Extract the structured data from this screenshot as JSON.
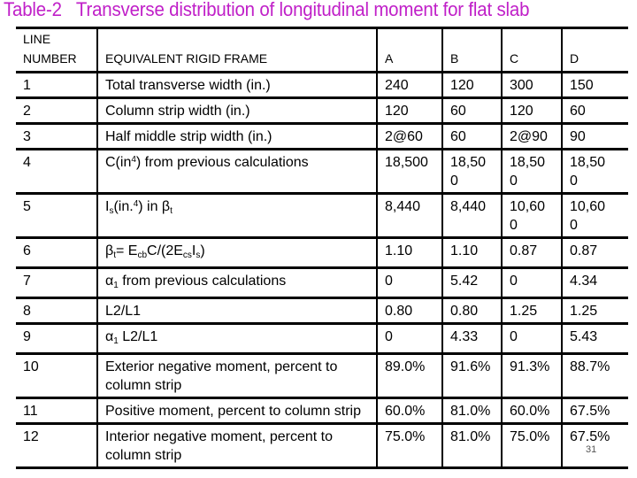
{
  "title": "Table-2   Transverse distribution of longitudinal moment for flat slab",
  "table": {
    "headers": {
      "line_number": [
        "LINE",
        "NUMBER"
      ],
      "frame": "EQUIVALENT RIGID FRAME",
      "A": "A",
      "B": "B",
      "C": "C",
      "D": "D"
    },
    "rows": [
      {
        "n": "1",
        "label": "Total transverse width (in.)",
        "A": "240",
        "B": "120",
        "C": "300",
        "D": "150"
      },
      {
        "n": "2",
        "label": "Column strip width (in.)",
        "A": "120",
        "B": "60",
        "C": "120",
        "D": "60"
      },
      {
        "n": "3",
        "label": "Half middle strip width (in.)",
        "A": "2@60",
        "B": "60",
        "C": "2@90",
        "D": "90"
      },
      {
        "n": "4",
        "label_parts": {
          "a": "C(in",
          "sup": "4",
          "b": ") from previous calculations"
        },
        "A": "18,500",
        "B": "18,500",
        "C": "18,500",
        "D": "18,500"
      },
      {
        "n": "5",
        "label_parts": {
          "a": "I",
          "sub1": "s",
          "b": "(in.",
          "sup": "4",
          "c": ") in β",
          "sub2": "t"
        },
        "A": "8,440",
        "B": "8,440",
        "C": "10,600",
        "D": "10,600"
      },
      {
        "n": "6",
        "label_parts": {
          "a": "β",
          "sub1": "t",
          "b": "= E",
          "sub2": "cb",
          "c": "C/(2E",
          "sub3": "cs",
          "d": "I",
          "sub4": "s",
          "e": ")"
        },
        "A": "1.10",
        "B": "1.10",
        "C": "0.87",
        "D": "0.87"
      },
      {
        "n": "7",
        "label_parts": {
          "a": "α",
          "sub": "1",
          "b": " from previous calculations"
        },
        "A": "0",
        "B": "5.42",
        "C": "0",
        "D": "4.34"
      },
      {
        "n": "8",
        "label": "L2/L1",
        "A": "0.80",
        "B": "0.80",
        "C": "1.25",
        "D": "1.25"
      },
      {
        "n": "9",
        "label_parts": {
          "a": "α",
          "sub": "1",
          "b": " L2/L1"
        },
        "A": "0",
        "B": "4.33",
        "C": "0",
        "D": "5.43"
      },
      {
        "n": "10",
        "label": "Exterior negative moment, percent to column strip",
        "A": "89.0%",
        "B": "91.6%",
        "C": "91.3%",
        "D": "88.7%"
      },
      {
        "n": "11",
        "label": "Positive moment, percent to column strip",
        "A": "60.0%",
        "B": "81.0%",
        "C": "60.0%",
        "D": "67.5%"
      },
      {
        "n": "12",
        "label": "Interior negative moment, percent to column strip",
        "A": "75.0%",
        "B": "81.0%",
        "C": "75.0%",
        "D": "67.5%"
      }
    ]
  },
  "page_number": "31",
  "colors": {
    "title": "#c020c8",
    "rule": "#000000"
  }
}
